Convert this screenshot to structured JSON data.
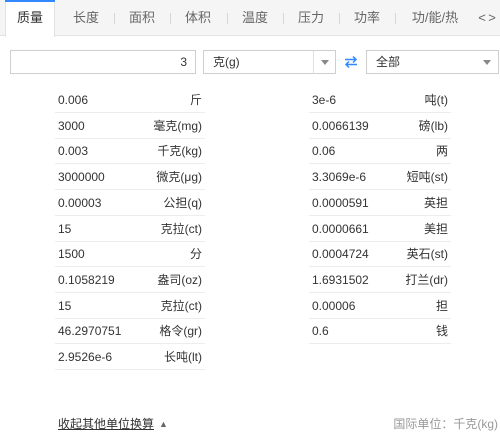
{
  "tabs": [
    "质量",
    "长度",
    "面积",
    "体积",
    "温度",
    "压力",
    "功率",
    "功/能/热"
  ],
  "active_tab": "质量",
  "tab_nav": {
    "prev": "<",
    "next": ">"
  },
  "converter": {
    "value": "3",
    "unit": "克(g)",
    "category": "全部"
  },
  "results_left": [
    {
      "value": "0.006",
      "unit": "斤"
    },
    {
      "value": "3000",
      "unit": "毫克(mg)"
    },
    {
      "value": "0.003",
      "unit": "千克(kg)"
    },
    {
      "value": "3000000",
      "unit": "微克(μg)"
    },
    {
      "value": "0.00003",
      "unit": "公担(q)"
    },
    {
      "value": "15",
      "unit": "克拉(ct)"
    },
    {
      "value": "1500",
      "unit": "分"
    },
    {
      "value": "0.1058219",
      "unit": "盎司(oz)"
    },
    {
      "value": "15",
      "unit": "克拉(ct)"
    },
    {
      "value": "46.2970751",
      "unit": "格令(gr)"
    },
    {
      "value": "2.9526e-6",
      "unit": "长吨(lt)"
    }
  ],
  "results_right": [
    {
      "value": "3e-6",
      "unit": "吨(t)"
    },
    {
      "value": "0.0066139",
      "unit": "磅(lb)"
    },
    {
      "value": "0.06",
      "unit": "两"
    },
    {
      "value": "3.3069e-6",
      "unit": "短吨(st)"
    },
    {
      "value": "0.0000591",
      "unit": "英担"
    },
    {
      "value": "0.0000661",
      "unit": "美担"
    },
    {
      "value": "0.0004724",
      "unit": "英石(st)"
    },
    {
      "value": "1.6931502",
      "unit": "打兰(dr)"
    },
    {
      "value": "0.00006",
      "unit": "担"
    },
    {
      "value": "0.6",
      "unit": "钱"
    }
  ],
  "footer": {
    "toggle_label": "收起其他单位换算",
    "si_note": "国际单位：千克(kg)"
  },
  "colors": {
    "accent": "#3388ff",
    "tab_bg": "#f5f5f5",
    "border": "#cfcfcf"
  },
  "icons": {
    "swap": "swap-arrows-icon",
    "dropdown": "caret-down-icon",
    "collapse": "caret-up-icon"
  }
}
